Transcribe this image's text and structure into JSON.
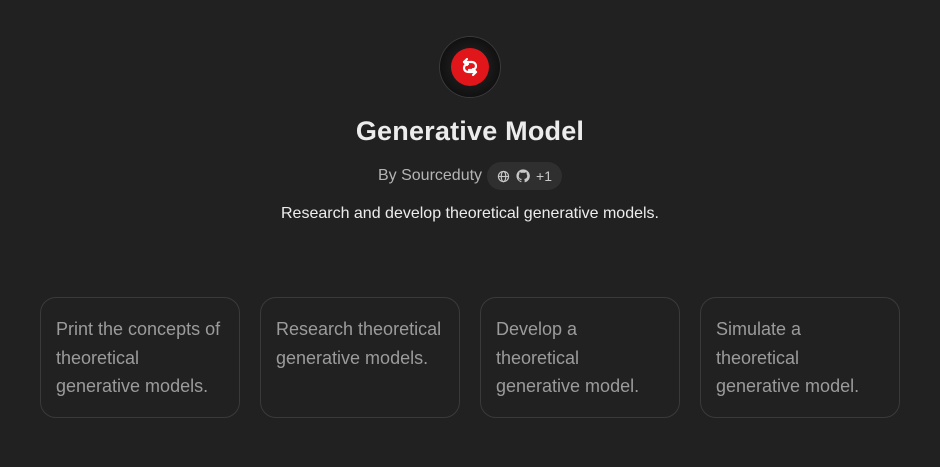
{
  "gpt": {
    "icon": "red-circle-swap-arrows-logo",
    "title": "Generative Model",
    "byline_prefix": "By Sourceduty",
    "badge_icons": [
      "globe-icon",
      "github-icon"
    ],
    "badge_extra": "+1",
    "description": "Research and develop theoretical generative models."
  },
  "starters": [
    {
      "label": "Print the concepts of theoretical generative models."
    },
    {
      "label": "Research theoretical generative models."
    },
    {
      "label": "Develop a theoretical generative model."
    },
    {
      "label": "Simulate a theoretical generative model."
    }
  ],
  "colors": {
    "background": "#212121",
    "accent": "#e0161b",
    "card_border": "#3a3a3a",
    "card_text": "#9b9b9b"
  }
}
